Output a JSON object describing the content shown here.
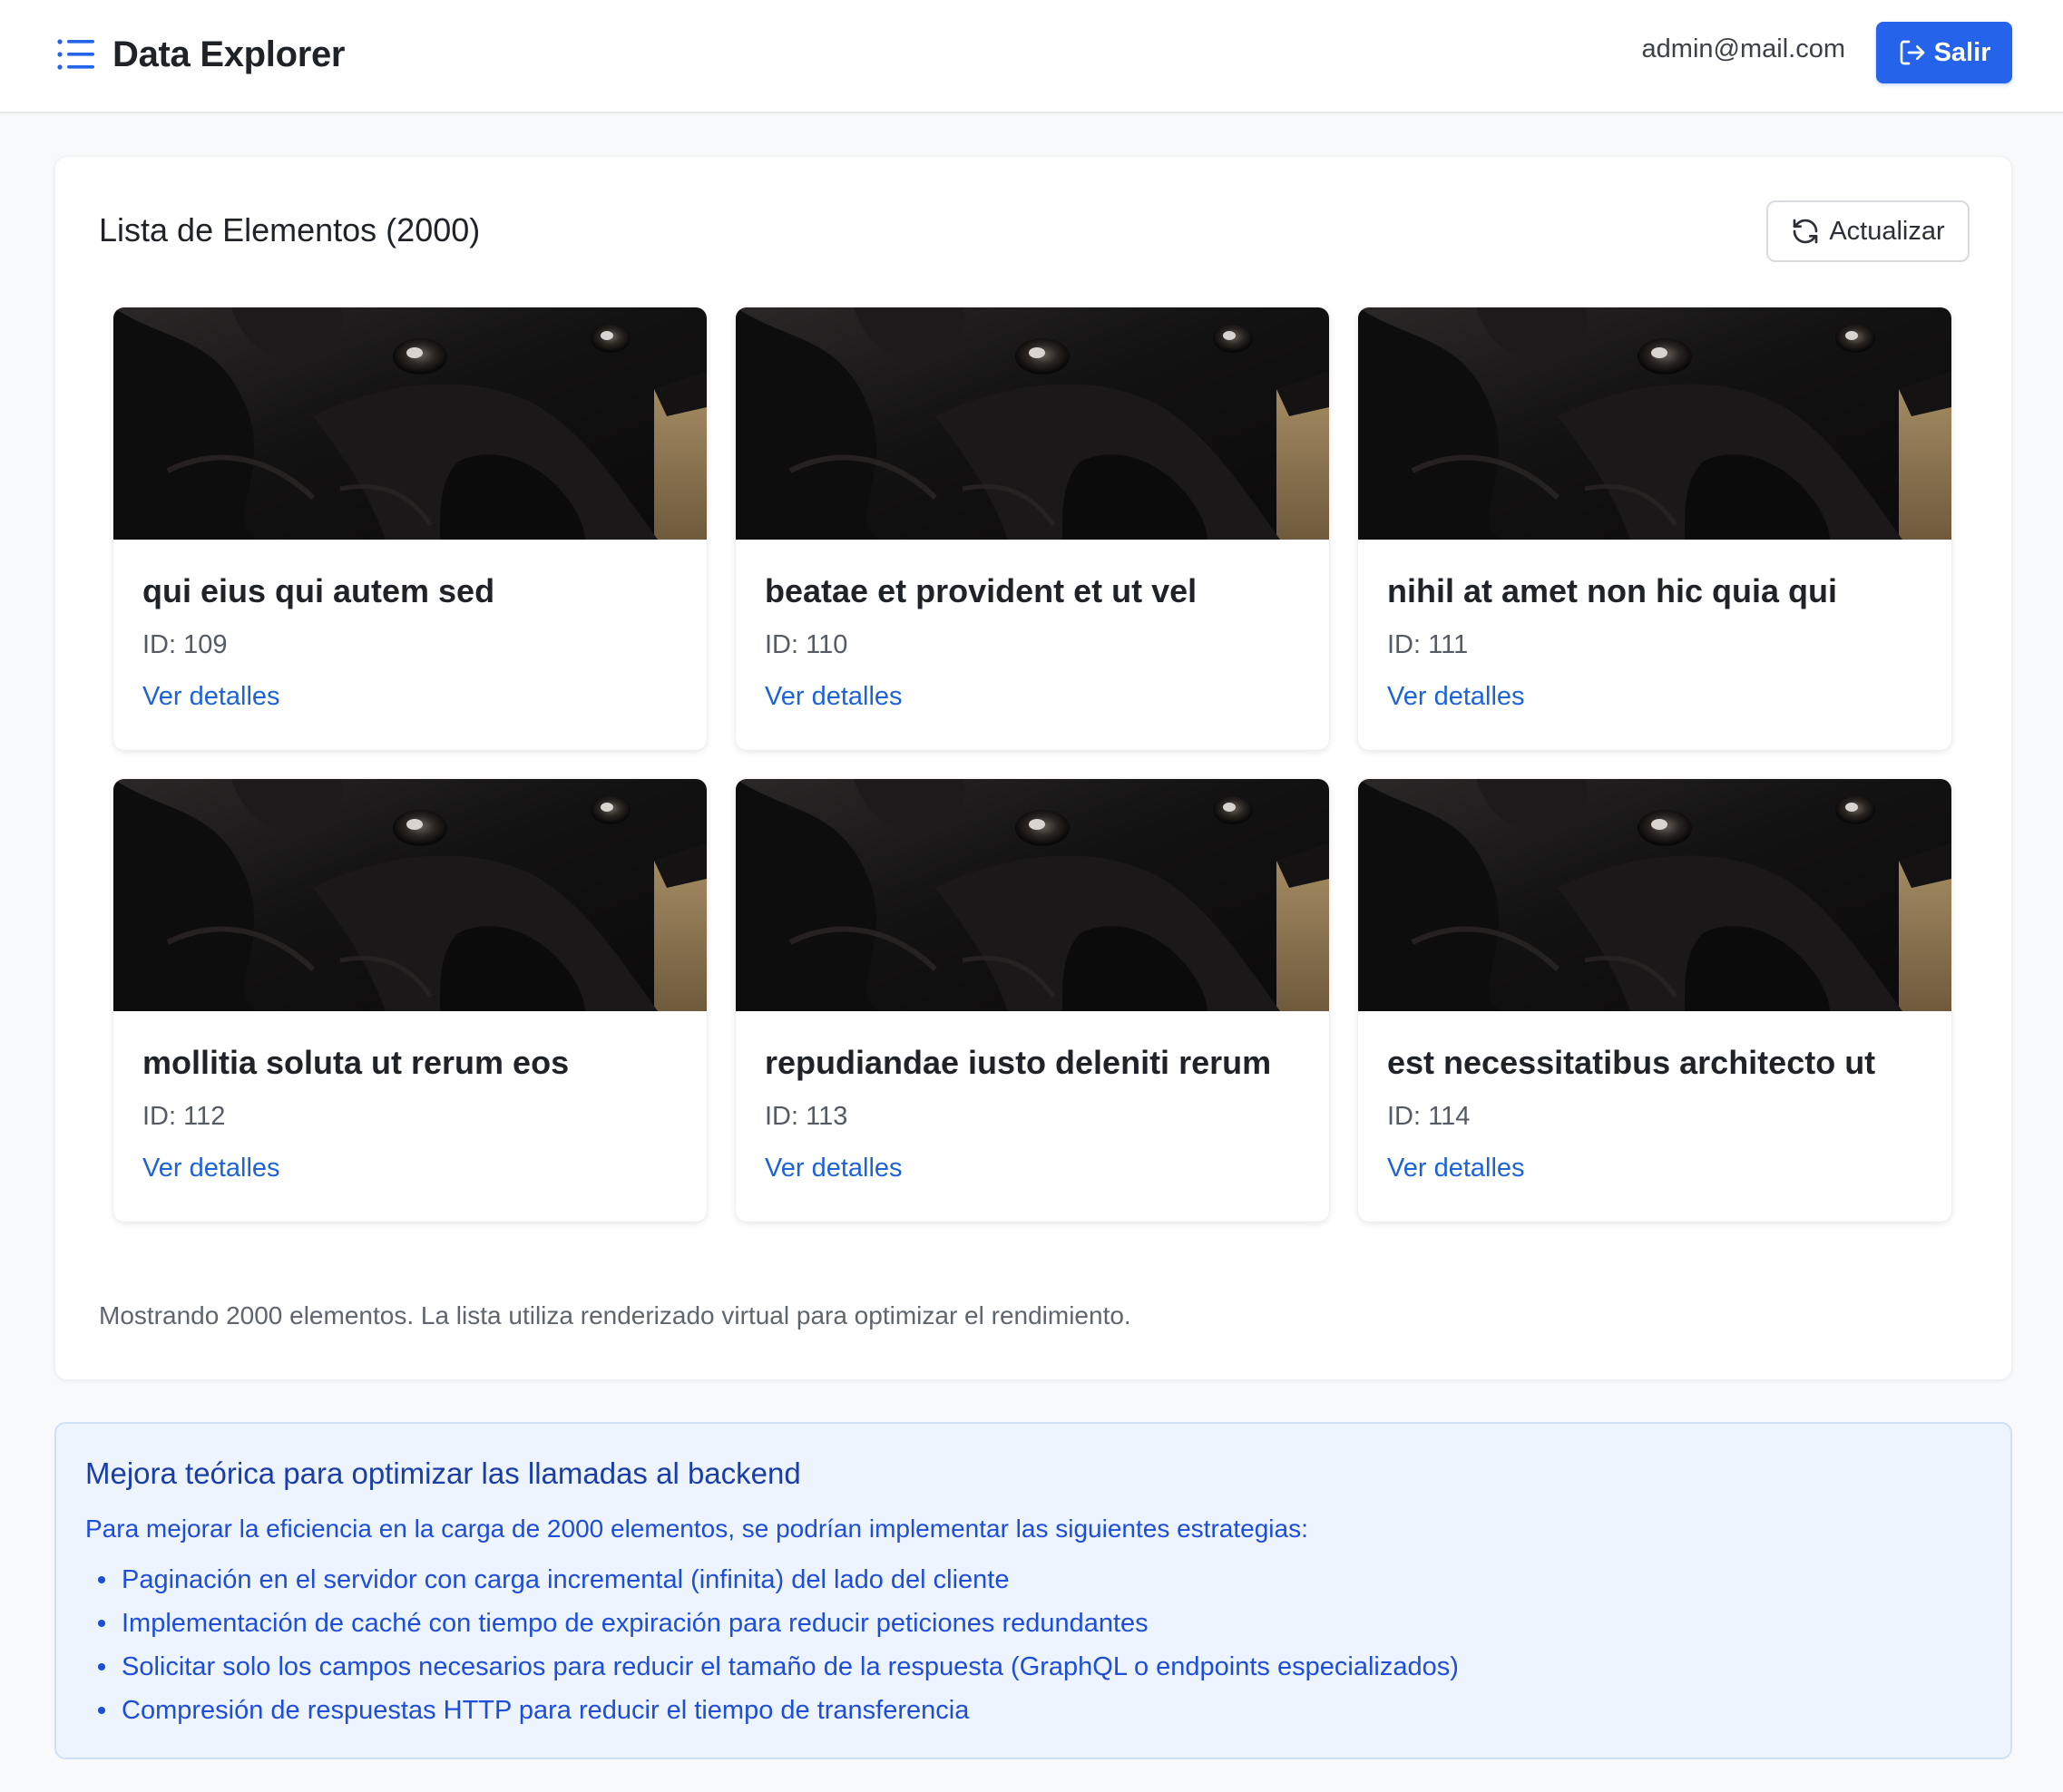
{
  "header": {
    "app_title": "Data Explorer",
    "user_email": "admin@mail.com",
    "logout_label": "Salir",
    "accent_color": "#2563eb"
  },
  "list": {
    "title": "Lista de Elementos (2000)",
    "refresh_label": "Actualizar",
    "items": [
      {
        "title": "qui eius qui autem sed",
        "id_text": "ID: 109",
        "link_label": "Ver detalles"
      },
      {
        "title": "beatae et provident et ut vel",
        "id_text": "ID: 110",
        "link_label": "Ver detalles"
      },
      {
        "title": "nihil at amet non hic quia qui",
        "id_text": "ID: 111",
        "link_label": "Ver detalles"
      },
      {
        "title": "mollitia soluta ut rerum eos",
        "id_text": "ID: 112",
        "link_label": "Ver detalles"
      },
      {
        "title": "repudiandae iusto deleniti rerum",
        "id_text": "ID: 113",
        "link_label": "Ver detalles"
      },
      {
        "title": "est necessitatibus architecto ut",
        "id_text": "ID: 114",
        "link_label": "Ver detalles"
      }
    ],
    "footer_note": "Mostrando 2000 elementos. La lista utiliza renderizado virtual para optimizar el rendimiento."
  },
  "info": {
    "title": "Mejora teórica para optimizar las llamadas al backend",
    "intro": "Para mejorar la eficiencia en la carga de 2000 elementos, se podrían implementar las siguientes estrategias:",
    "bullets": [
      "Paginación en el servidor con carga incremental (infinita) del lado del cliente",
      "Implementación de caché con tiempo de expiración para reducir peticiones redundantes",
      "Solicitar solo los campos necesarios para reducir el tamaño de la respuesta (GraphQL o endpoints especializados)",
      "Compresión de respuestas HTTP para reducir el tiempo de transferencia"
    ]
  },
  "icons": {
    "menu": "list-icon",
    "logout": "logout-icon",
    "refresh": "refresh-icon",
    "thumbnail": "dog-photo"
  }
}
